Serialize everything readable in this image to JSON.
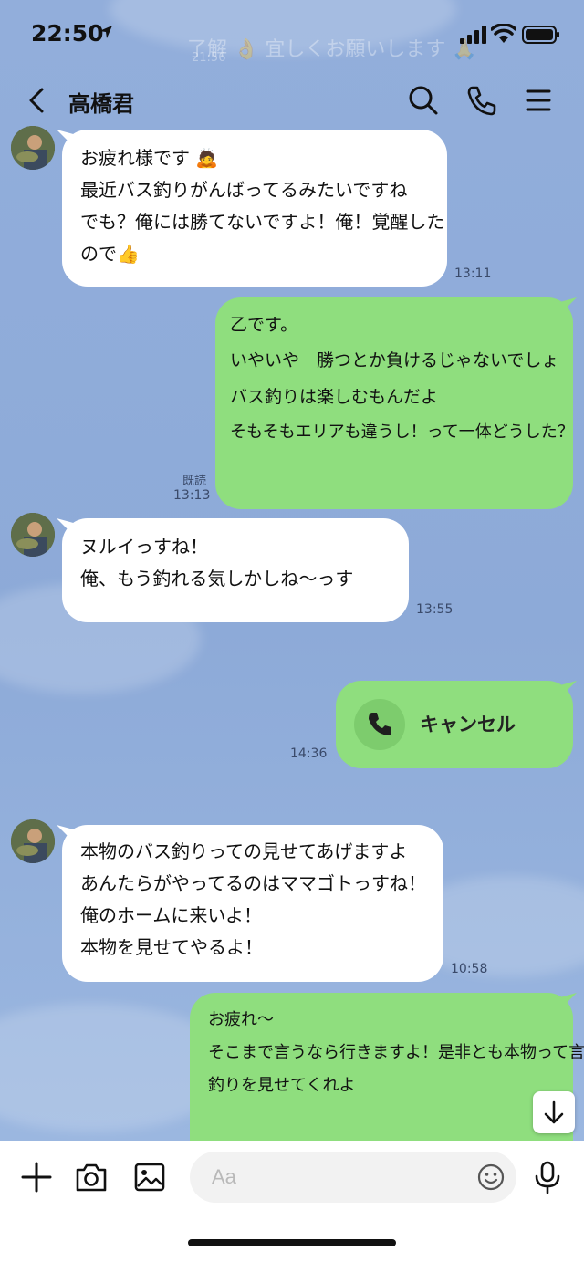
{
  "status_bar": {
    "time": "22:50"
  },
  "ghost_notification": {
    "preview": "了解 👌 宜しくお願いします 🙏",
    "time": "21:56"
  },
  "header": {
    "title": "高橋君"
  },
  "messages": [
    {
      "dir": "in",
      "lines": [
        "お疲れ様です 🙇",
        "最近バス釣りがんばってるみたいですね",
        "でも？俺には勝てないですよ！俺！覚醒した",
        "ので👍"
      ],
      "time": "13:11"
    },
    {
      "dir": "out",
      "lines": [
        "乙です。",
        "いやいや　勝つとか負けるじゃないでしょ",
        "バス釣りは楽しむもんだよ",
        "そもそもエリアも違うし！って一体どうした？"
      ],
      "time": "13:13",
      "read": "既読"
    },
    {
      "dir": "in",
      "lines": [
        "ヌルイっすね！",
        "俺、もう釣れる気しかしね〜っす"
      ],
      "time": "13:55"
    },
    {
      "dir": "out",
      "call_label": "キャンセル",
      "time": "14:36"
    },
    {
      "dir": "in",
      "lines": [
        "本物のバス釣りっての見せてあげますよ",
        "あんたらがやってるのはママゴトっすね！",
        "俺のホームに来いよ！",
        "本物を見せてやるよ！"
      ],
      "time": "10:58"
    },
    {
      "dir": "out",
      "lines": [
        "お疲れ〜",
        "そこまで言うなら行きますよ！是非とも本物って言う",
        "釣りを見せてくれよ"
      ]
    }
  ],
  "composer": {
    "placeholder": "Aa"
  },
  "colors": {
    "background": "#8eacd8",
    "outgoing_bubble": "#8fde7e",
    "incoming_bubble": "#ffffff"
  }
}
